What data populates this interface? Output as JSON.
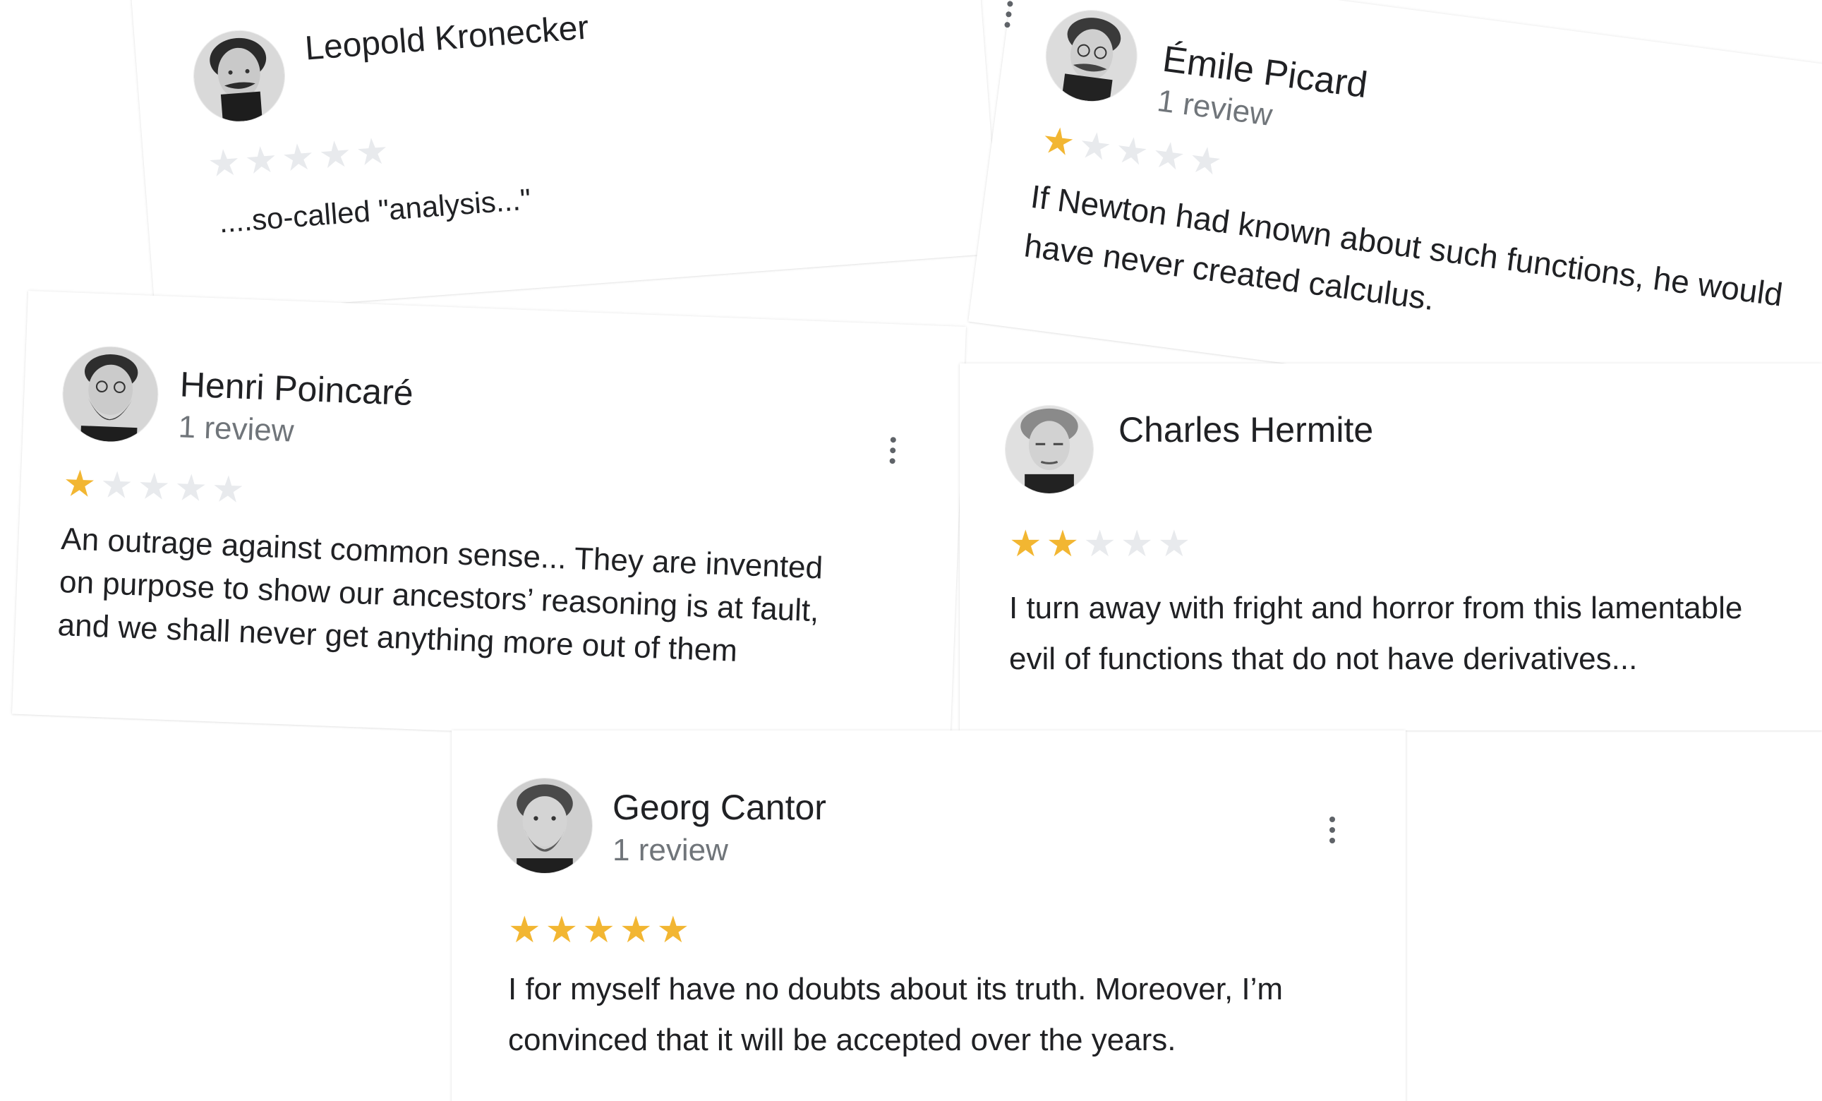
{
  "reviews": {
    "kronecker": {
      "name": "Leopold Kronecker",
      "review_count": "",
      "stars": 0,
      "text": "....so-called \"analysis...\"",
      "avatar_icon": "portrait-mustache"
    },
    "picard": {
      "name": "Émile Picard",
      "review_count": "1 review",
      "stars": 1,
      "text_lines": [
        "If Newton had known about such functions, he would",
        "have never created calculus."
      ],
      "avatar_icon": "portrait-mustache-glasses"
    },
    "poincare": {
      "name": "Henri Poincaré",
      "review_count": "1 review",
      "stars": 1,
      "text_lines": [
        "An outrage against common sense... They are invented",
        "on purpose to show our ancestors’ reasoning is at fault,",
        "and we shall never get anything more out of them"
      ],
      "avatar_icon": "portrait-beard-glasses"
    },
    "hermite": {
      "name": "Charles Hermite",
      "review_count": "",
      "stars": 2,
      "text_lines": [
        "I turn away with fright and horror from this lamentable",
        "evil of functions that do not have derivatives..."
      ],
      "avatar_icon": "portrait-elderly"
    },
    "cantor": {
      "name": "Georg Cantor",
      "review_count": "1 review",
      "stars": 5,
      "text_lines": [
        "I for myself have no doubts about its truth. Moreover, I’m",
        "convinced that it will be accepted over the years."
      ],
      "avatar_icon": "portrait-beard"
    }
  },
  "icons": {
    "menu": "more-vert-icon",
    "star": "star-icon"
  },
  "colors": {
    "star_filled": "#f2b632",
    "star_empty": "#e8eaed",
    "secondary_text": "#70757a",
    "primary_text": "#202124"
  }
}
